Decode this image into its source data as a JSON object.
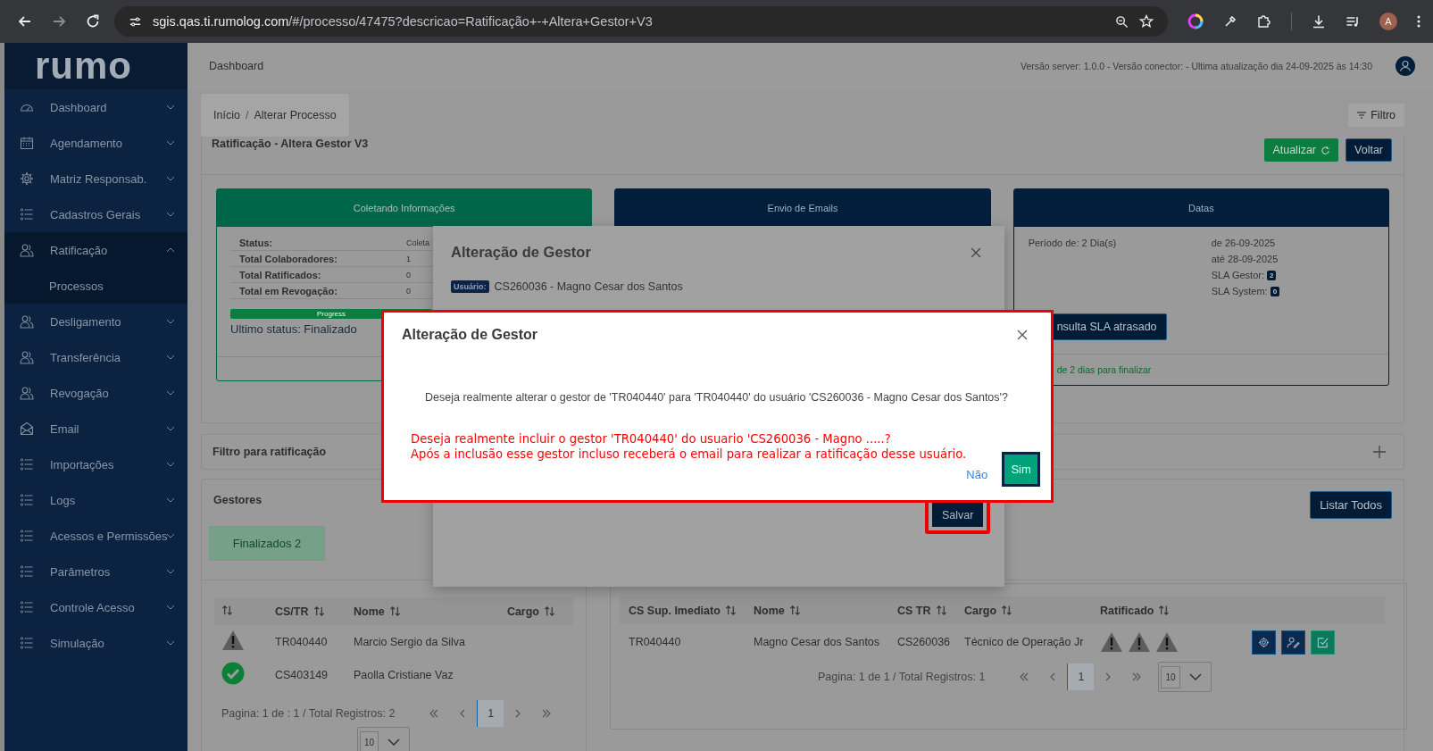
{
  "browser": {
    "url_host": "sgis.qas.ti.rumolog.com",
    "url_path": "/#/processo/47475?descricao=Ratificação+-+Altera+Gestor+V3",
    "avatar": "A"
  },
  "sidebar": {
    "logo": "rumo",
    "items": [
      {
        "label": "Dashboard",
        "kind": "gauge",
        "expanded": false
      },
      {
        "label": "Agendamento",
        "kind": "calendar",
        "expanded": false
      },
      {
        "label": "Matriz Responsab.",
        "kind": "gear",
        "expanded": false
      },
      {
        "label": "Cadastros Gerais",
        "kind": "list",
        "expanded": false
      },
      {
        "label": "Ratificação",
        "kind": "people",
        "expanded": true,
        "children": [
          {
            "label": "Processos"
          }
        ]
      },
      {
        "label": "Desligamento",
        "kind": "people",
        "expanded": false
      },
      {
        "label": "Transferência",
        "kind": "people",
        "expanded": false
      },
      {
        "label": "Revogação",
        "kind": "people",
        "expanded": false
      },
      {
        "label": "Email",
        "kind": "mail",
        "expanded": false
      },
      {
        "label": "Importações",
        "kind": "list",
        "expanded": false
      },
      {
        "label": "Logs",
        "kind": "list",
        "expanded": false
      },
      {
        "label": "Acessos e Permissões",
        "kind": "list",
        "expanded": false
      },
      {
        "label": "Parâmetros",
        "kind": "list",
        "expanded": false
      },
      {
        "label": "Controle Acesso",
        "kind": "list",
        "expanded": false
      },
      {
        "label": "Simulação",
        "kind": "list",
        "expanded": false
      }
    ]
  },
  "header": {
    "title": "Dashboard",
    "version": "Versão server: 1.0.0 -  Versão conector: -  Ultima atualização dia 24-09-2025 às 14:30"
  },
  "breadcrumb": {
    "items": [
      "Início",
      "Alterar Processo"
    ],
    "separator": "/"
  },
  "filter_button": "Filtro",
  "process": {
    "title": "Ratificação - Altera Gestor V3",
    "buttons": [
      {
        "label": "Atualizar",
        "kind": "refresh"
      },
      {
        "label": "Voltar",
        "kind": "plain"
      }
    ]
  },
  "cards": [
    {
      "kind": "info",
      "title": "Coletando Informações",
      "color": "#00664a",
      "rows": [
        {
          "label": "Status:",
          "value": "Coleta"
        },
        {
          "label": "Total Colaboradores:",
          "value": "1"
        },
        {
          "label": "Total Ratificados:",
          "value": "0"
        },
        {
          "label": "Total em Revogação:",
          "value": "0"
        }
      ],
      "progress": {
        "label": "Progress",
        "level": 1
      },
      "last_status": "Ultimo status: Finalizado"
    },
    {
      "kind": "plain",
      "title": "Envio de Emails",
      "color": "#011e3a"
    },
    {
      "kind": "dates",
      "title": "Datas",
      "color": "#011e3a",
      "period": "Período de: 2 Dia(s)",
      "dates": [
        "de 26-09-2025",
        "até 28-09-2025"
      ],
      "sla": [
        {
          "label": "SLA Gestor:",
          "count": "2"
        },
        {
          "label": "SLA System:",
          "count": "0"
        }
      ],
      "button": "nsulta SLA atrasado",
      "footer": "de 2 dias para finalizar"
    }
  ],
  "filter_panel": {
    "title": "Filtro para ratificação",
    "expanded": false
  },
  "gestores": {
    "title": "Gestores",
    "status_button": "Finalizados 2",
    "list_all": "Listar Todos",
    "left_table": {
      "columns": [
        "CS/TR",
        "Nome",
        "Cargo"
      ],
      "rows": [
        {
          "kind": "warning",
          "cs_tr": "TR040440",
          "nome": "Marcio Sergio da Silva"
        },
        {
          "kind": "done",
          "cs_tr": "CS403149",
          "nome": "Paolla Cristiane Vaz"
        }
      ],
      "pagination": {
        "text": "Pagina: 1 de : 1 / Total Registros: 2",
        "pages": [
          {
            "label": "1",
            "selected": true
          }
        ],
        "page_size": "10"
      }
    },
    "right_table": {
      "columns": [
        "CS Sup. Imediato",
        "Nome",
        "CS TR",
        "Cargo",
        "Ratificado"
      ],
      "rows": [
        {
          "cells": [
            "TR040440",
            "Magno Cesar dos Santos",
            "CS260036",
            "Técnico de Operação Jr"
          ],
          "ratificado": [
            {
              "kind": "warning"
            },
            {
              "kind": "warning"
            },
            {
              "kind": "warning"
            }
          ],
          "actions": [
            {
              "kind": "settings"
            },
            {
              "kind": "user-edit"
            },
            {
              "kind": "approve"
            }
          ]
        }
      ],
      "pagination": {
        "text": "Pagina: 1 de 1 / Total Registros: 1",
        "pages": [
          {
            "label": "1",
            "selected": true
          }
        ],
        "page_size": "10"
      }
    }
  },
  "modal_back": {
    "title": "Alteração de Gestor",
    "user_label": "Usuário:",
    "user_value": "CS260036 - Magno Cesar dos Santos",
    "save_button": "Salvar",
    "save_highlighted": true
  },
  "modal_front": {
    "title": "Alteração de Gestor",
    "highlighted": true,
    "message": "Deseja realmente alterar o gestor de 'TR040440' para 'TR040440' do usuário 'CS260036 - Magno Cesar dos Santos'?",
    "warning": [
      "Deseja realmente incluir o gestor 'TR040440' do usuario 'CS260036 - Magno .....?",
      "Após a inclusão esse gestor incluso receberá o email para realizar a ratificação desse usuário."
    ],
    "cancel": "Não",
    "confirm": "Sim"
  }
}
